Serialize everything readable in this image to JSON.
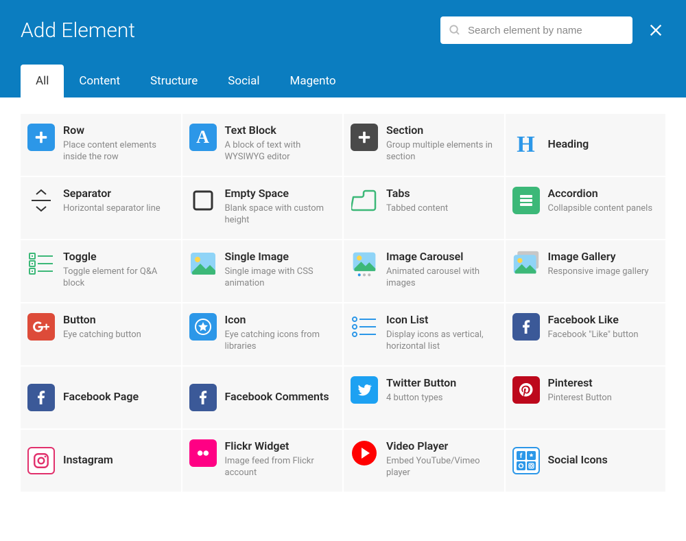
{
  "header": {
    "title": "Add Element",
    "search_placeholder": "Search element by name"
  },
  "tabs": [
    {
      "label": "All",
      "active": true
    },
    {
      "label": "Content",
      "active": false
    },
    {
      "label": "Structure",
      "active": false
    },
    {
      "label": "Social",
      "active": false
    },
    {
      "label": "Magento",
      "active": false
    }
  ],
  "elements": [
    {
      "title": "Row",
      "desc": "Place content elements inside the row",
      "icon": "plus-blue"
    },
    {
      "title": "Text Block",
      "desc": "A block of text with WYSIWYG editor",
      "icon": "letter-a"
    },
    {
      "title": "Section",
      "desc": "Group multiple elements in section",
      "icon": "plus-dark"
    },
    {
      "title": "Heading",
      "desc": "",
      "icon": "heading-h"
    },
    {
      "title": "Separator",
      "desc": "Horizontal separator line",
      "icon": "separator"
    },
    {
      "title": "Empty Space",
      "desc": "Blank space with custom height",
      "icon": "empty-square"
    },
    {
      "title": "Tabs",
      "desc": "Tabbed content",
      "icon": "tabs"
    },
    {
      "title": "Accordion",
      "desc": "Collapsible content panels",
      "icon": "accordion"
    },
    {
      "title": "Toggle",
      "desc": "Toggle element for Q&A block",
      "icon": "toggle"
    },
    {
      "title": "Single Image",
      "desc": "Single image with CSS animation",
      "icon": "image-single"
    },
    {
      "title": "Image Carousel",
      "desc": "Animated carousel with images",
      "icon": "image-carousel"
    },
    {
      "title": "Image Gallery",
      "desc": "Responsive image gallery",
      "icon": "image-gallery"
    },
    {
      "title": "Button",
      "desc": "Eye catching button",
      "icon": "gplus"
    },
    {
      "title": "Icon",
      "desc": "Eye catching icons from libraries",
      "icon": "star-circle"
    },
    {
      "title": "Icon List",
      "desc": "Display icons as vertical, horizontal list",
      "icon": "icon-list"
    },
    {
      "title": "Facebook Like",
      "desc": "Facebook \"Like\" button",
      "icon": "facebook"
    },
    {
      "title": "Facebook Page",
      "desc": "",
      "icon": "facebook"
    },
    {
      "title": "Facebook Comments",
      "desc": "",
      "icon": "facebook"
    },
    {
      "title": "Twitter Button",
      "desc": "4 button types",
      "icon": "twitter"
    },
    {
      "title": "Pinterest",
      "desc": "Pinterest Button",
      "icon": "pinterest"
    },
    {
      "title": "Instagram",
      "desc": "",
      "icon": "instagram"
    },
    {
      "title": "Flickr Widget",
      "desc": "Image feed from Flickr account",
      "icon": "flickr"
    },
    {
      "title": "Video Player",
      "desc": "Embed YouTube/Vimeo player",
      "icon": "play"
    },
    {
      "title": "Social Icons",
      "desc": "",
      "icon": "social-grid"
    }
  ]
}
